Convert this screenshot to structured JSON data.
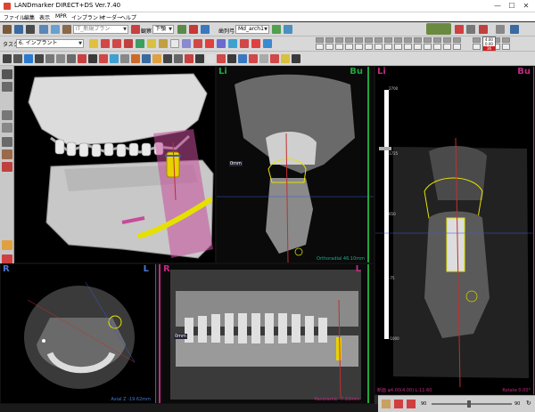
{
  "window": {
    "title": "LANDmarker DIRECT+DS Ver.7.40",
    "minimize": "—",
    "maximize": "☐",
    "close": "✕"
  },
  "menu": [
    "ファイル",
    "編集",
    "表示",
    "MPR",
    "インプラント",
    "オーダー",
    "ヘルプ"
  ],
  "toolbar1": {
    "plan_combo": "IT_新規プラン",
    "view_label": "観察",
    "view_value": "下顎",
    "arch_label": "歯列弓",
    "arch_value": "Md_arch1"
  },
  "toolbar2": {
    "task_label": "タスク",
    "task_value": "6. インプラント",
    "slot_values": [
      "4.00",
      "0.00",
      "36"
    ]
  },
  "viewports": {
    "vp3d": {
      "corner": ""
    },
    "cross1": {
      "left_label": "Li",
      "right_label": "Bu",
      "status": "Orthoradial 46.10mm",
      "badge": "0mm"
    },
    "cross2": {
      "left_label": "Li",
      "right_label": "Bu",
      "status_left": "断面 φ4.00(4.00) L:11.60",
      "status_right": "Rotate 0.00°",
      "scale_top": "2700",
      "scale_mid1": "1725",
      "scale_mid2": "650",
      "scale_mid3": "-75",
      "scale_bottom": "-1000"
    },
    "axial": {
      "left_label": "R",
      "right_label": "L",
      "status": "Axial Z -19.62mm"
    },
    "pano": {
      "left_label": "R",
      "right_label": "L",
      "status": "Panoramic -7.33mm",
      "badge": "0mm"
    }
  },
  "bottom": {
    "left_value": "90",
    "right_value": "90"
  },
  "colors": {
    "accent_green": "#1fa63b",
    "accent_magenta": "#c02a80",
    "implant_yellow": "#e8d200",
    "canal_yellow": "#e6e000"
  }
}
